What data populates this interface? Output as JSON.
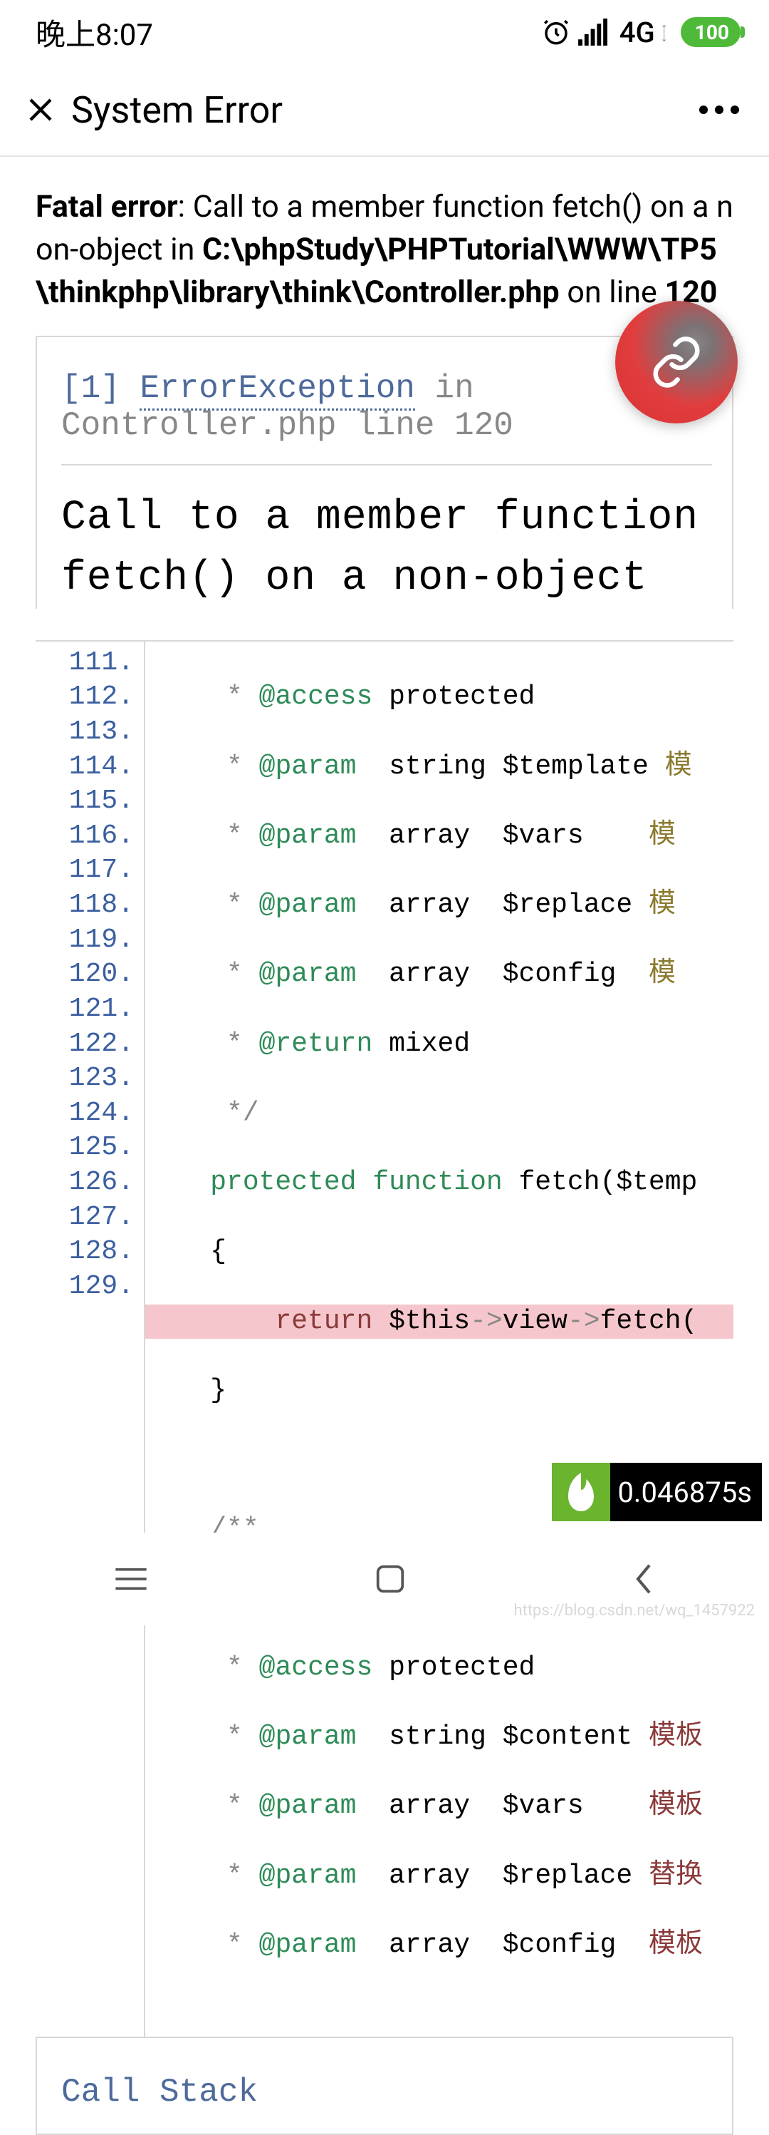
{
  "status": {
    "time": "晚上8:07",
    "network": "4G",
    "battery": "100"
  },
  "titlebar": {
    "title": "System Error"
  },
  "fatal": {
    "label": "Fatal error",
    "message1": ": Call to a member function fetch() on a non-object in ",
    "path": "C:\\phpStudy\\PHPTutorial\\WWW\\TP5\\thinkphp\\library\\think\\Controller.php",
    "online": " on line ",
    "line": "120"
  },
  "panel": {
    "index": "[1]",
    "exception": "ErrorException",
    "in": "in",
    "location": "Controller.php line 120",
    "message": "Call to a member function fetch() on a non-object"
  },
  "code": {
    "lines": [
      "111.",
      "112.",
      "113.",
      "114.",
      "115.",
      "116.",
      "117.",
      "118.",
      "119.",
      "120.",
      "121.",
      "122.",
      "123.",
      "124.",
      "125.",
      "126.",
      "127.",
      "128.",
      "129."
    ]
  },
  "call_stack": "Call Stack",
  "timer": "0.046875s"
}
